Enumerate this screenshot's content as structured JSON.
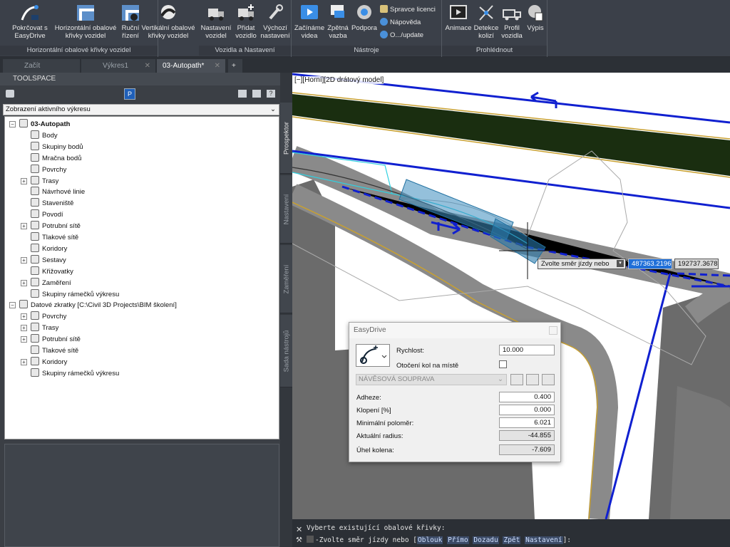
{
  "ribbon": {
    "panels": [
      {
        "title": "Horizontální obalové křivky vozidel",
        "buttons": [
          {
            "label1": "Pokrčovat s",
            "label2": "EasyDrive"
          },
          {
            "label1": "Horizontální obalové",
            "label2": "křivky vozidel"
          },
          {
            "label1": "Ruční",
            "label2": "řízení"
          },
          {
            "label1": "Vertikální obalové",
            "label2": "křivky vozidel"
          }
        ]
      },
      {
        "title": "Vozidla a Nastavení",
        "buttons": [
          {
            "label1": "Nastavení",
            "label2": "vozidel"
          },
          {
            "label1": "Přidat",
            "label2": "vozidlo"
          },
          {
            "label1": "Výchozí",
            "label2": "nastavení"
          }
        ]
      },
      {
        "title": "Nástroje",
        "buttons": [
          {
            "label1": "Začínáme",
            "label2": "videa"
          },
          {
            "label1": "Zpětná",
            "label2": "vazba"
          },
          {
            "label1": "Podpora",
            "label2": ""
          }
        ],
        "small": [
          "Spravce licenci",
          "Nápověda",
          "O.../update"
        ]
      },
      {
        "title": "Prohlédnout",
        "buttons": [
          {
            "label1": "Animace",
            "label2": ""
          },
          {
            "label1": "Detekce",
            "label2": "kolizí"
          },
          {
            "label1": "Profil",
            "label2": "vozidla"
          },
          {
            "label1": "Výpis",
            "label2": ""
          }
        ]
      }
    ]
  },
  "tabs": [
    {
      "label": "Začít"
    },
    {
      "label": "Výkres1"
    },
    {
      "label": "03-Autopath*"
    }
  ],
  "toolspace": {
    "title": "TOOLSPACE",
    "view_select": "Zobrazení aktivního výkresu",
    "tree": [
      {
        "label": "03-Autopath",
        "level": 0,
        "expander": "-",
        "bold": true
      },
      {
        "label": "Body",
        "level": 1
      },
      {
        "label": "Skupiny bodů",
        "level": 1
      },
      {
        "label": "Mračna bodů",
        "level": 1
      },
      {
        "label": "Povrchy",
        "level": 1
      },
      {
        "label": "Trasy",
        "level": 1,
        "expander": "+"
      },
      {
        "label": "Návrhové linie",
        "level": 1
      },
      {
        "label": "Staveniště",
        "level": 1
      },
      {
        "label": "Povodí",
        "level": 1
      },
      {
        "label": "Potrubní sítě",
        "level": 1,
        "expander": "+"
      },
      {
        "label": "Tlakové sítě",
        "level": 1
      },
      {
        "label": "Koridory",
        "level": 1
      },
      {
        "label": "Sestavy",
        "level": 1,
        "expander": "+"
      },
      {
        "label": "Křižovatky",
        "level": 1
      },
      {
        "label": "Zaměření",
        "level": 1,
        "expander": "+"
      },
      {
        "label": "Skupiny rámečků výkresu",
        "level": 1
      },
      {
        "label": "Datové zkratky [C:\\Civil 3D Projects\\BIM školení]",
        "level": 0,
        "expander": "-"
      },
      {
        "label": "Povrchy",
        "level": 1,
        "expander": "+"
      },
      {
        "label": "Trasy",
        "level": 1,
        "expander": "+"
      },
      {
        "label": "Potrubní sítě",
        "level": 1,
        "expander": "+"
      },
      {
        "label": "Tlakové sítě",
        "level": 1
      },
      {
        "label": "Koridory",
        "level": 1,
        "expander": "+"
      },
      {
        "label": "Skupiny rámečků výkresu",
        "level": 1
      }
    ],
    "side_tabs": [
      "Prospektor",
      "Nastavení",
      "Zaměření",
      "Sada nástrojů"
    ]
  },
  "viewport": {
    "label": "[−][Horní][2D drátový model]",
    "prompt": "Zvolte směr jízdy nebo",
    "coord_x": "487363.2196",
    "coord_y": "192737.3678"
  },
  "easydrive": {
    "title": "EasyDrive",
    "speed_label": "Rychlost:",
    "speed_value": "10.000",
    "turn_label": "Otočení kol na místě",
    "vehicle": "NÁVĚSOVÁ SOUPRAVA",
    "fields": [
      {
        "label": "Adheze:",
        "value": "0.400",
        "readonly": false
      },
      {
        "label": "Klopení [%]",
        "value": "0.000",
        "readonly": false
      },
      {
        "label": "Minimální poloměr:",
        "value": "6.021",
        "readonly": false
      },
      {
        "label": "Aktuální radius:",
        "value": "-44.855",
        "readonly": true
      },
      {
        "label": "Úhel kolena:",
        "value": "-7.609",
        "readonly": true
      }
    ]
  },
  "command": {
    "history": "Vyberte existující obalové křivky:",
    "prompt_prefix": "-Zvolte směr jízdy nebo [",
    "keywords": [
      "Oblouk",
      "Přímo",
      "Dozadu",
      "Zpět",
      "Nastavení"
    ],
    "prompt_suffix": "]:"
  }
}
